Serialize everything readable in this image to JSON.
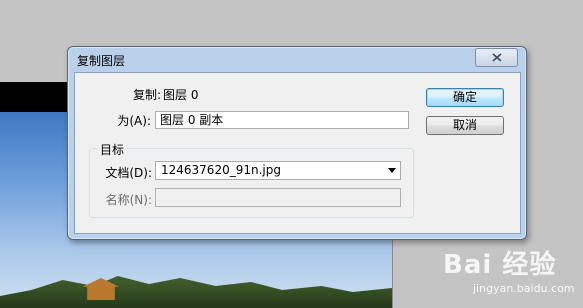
{
  "dialog": {
    "title": "复制图层",
    "copy_label": "复制:",
    "copy_value": "图层 0",
    "as_label": "为(A):",
    "as_value": "图层 0 副本",
    "ok_label": "确定",
    "cancel_label": "取消",
    "destination": {
      "group_title": "目标",
      "document_label": "文档(D):",
      "document_value": "124637620_91n.jpg",
      "name_label": "名称(N):",
      "name_value": ""
    }
  },
  "watermark": {
    "brand": "Bai 经验",
    "url": "jingyan.baidu.com"
  },
  "icons": {
    "close": "close-icon",
    "dropdown": "chevron-down-icon"
  }
}
